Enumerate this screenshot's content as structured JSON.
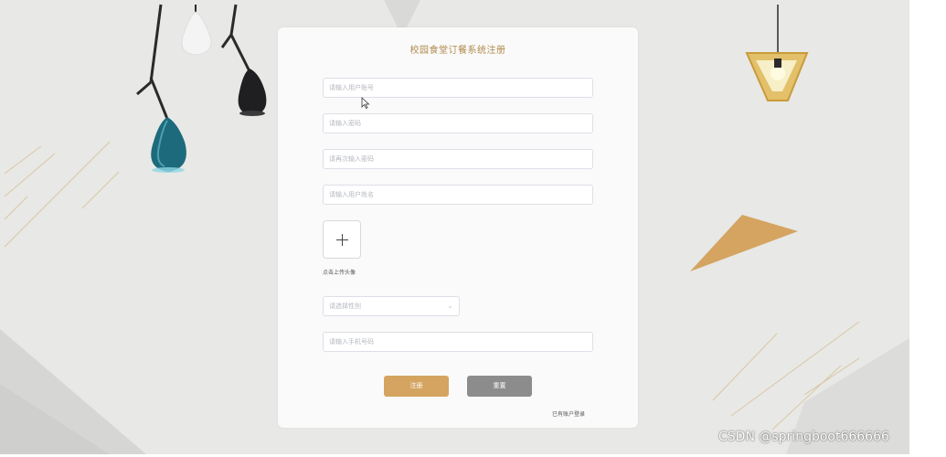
{
  "form": {
    "title": "校园食堂订餐系统注册",
    "account_placeholder": "请输入用户账号",
    "password_placeholder": "请输入密码",
    "confirm_password_placeholder": "请再次输入密码",
    "name_placeholder": "请输入用户姓名",
    "upload_label": "点击上传头像",
    "gender_placeholder": "请选择性别",
    "phone_placeholder": "请输入手机号码",
    "register_label": "注册",
    "reset_label": "重置",
    "login_link": "已有账户登录"
  },
  "icons": {
    "upload": "plus-icon",
    "select": "chevron-down-icon",
    "cursor": "mouse-cursor-icon"
  },
  "colors": {
    "accent": "#d4a460",
    "title": "#b0894a",
    "reset": "#8c8c8c",
    "background": "#e8e8e6"
  },
  "watermark": "CSDN @springboot666666"
}
